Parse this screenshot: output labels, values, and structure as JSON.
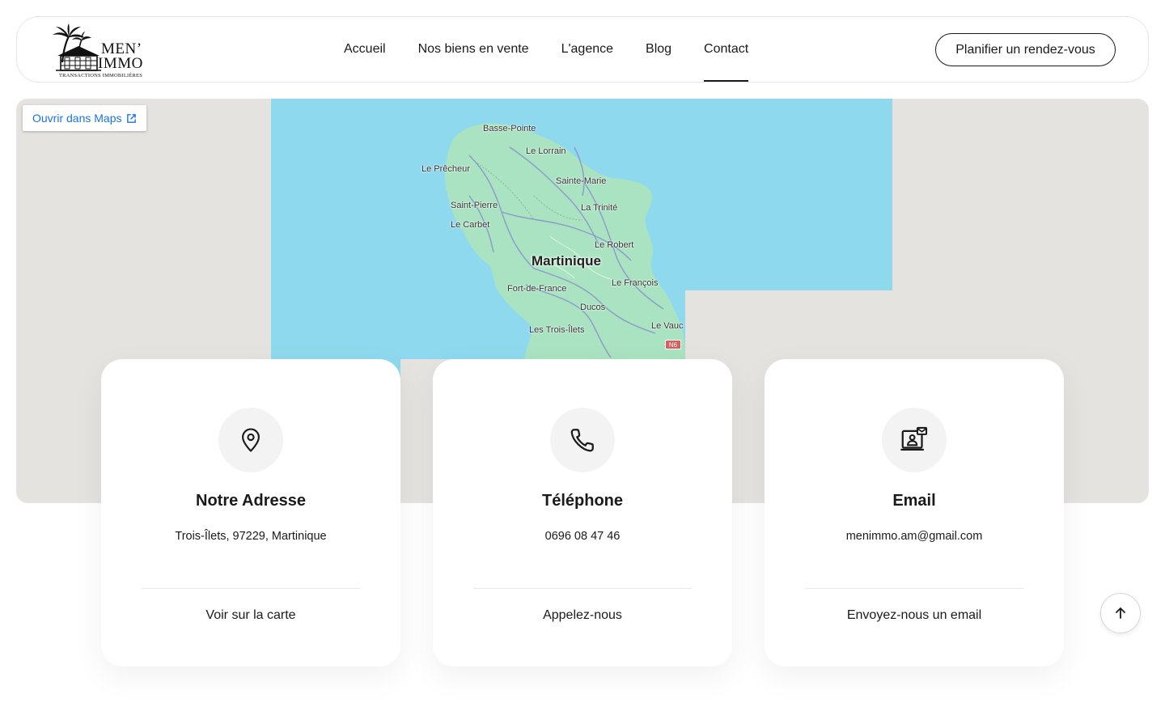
{
  "header": {
    "logo": {
      "brand_line1": "MEN’",
      "brand_line2": "IMMO",
      "tagline": "TRANSACTIONS IMMOBILIÈRES"
    },
    "nav": [
      {
        "label": "Accueil",
        "active": false
      },
      {
        "label": "Nos biens en vente",
        "active": false
      },
      {
        "label": "L'agence",
        "active": false
      },
      {
        "label": "Blog",
        "active": false
      },
      {
        "label": "Contact",
        "active": true
      }
    ],
    "cta_label": "Planifier un rendez-vous"
  },
  "map": {
    "open_link_label": "Ouvrir dans Maps",
    "region_label": "Martinique",
    "cities": [
      "Basse-Pointe",
      "Le Lorrain",
      "Le Prêcheur",
      "Sainte-Marie",
      "Saint-Pierre",
      "La Trinité",
      "Le Carbet",
      "Le Robert",
      "Le François",
      "Fort-de-France",
      "Ducos",
      "Les Trois-Îlets",
      "Le Vauc"
    ],
    "road_label": "N6",
    "colors": {
      "water": "#8fd9ee",
      "land": "#a9e3c1",
      "background": "#e4e3df"
    }
  },
  "cards": [
    {
      "icon": "location-pin-icon",
      "title": "Notre Adresse",
      "value": "Trois-Îlets, 97229, Martinique",
      "action": "Voir sur la carte"
    },
    {
      "icon": "phone-icon",
      "title": "Téléphone",
      "value": "0696 08 47 46",
      "action": "Appelez-nous"
    },
    {
      "icon": "email-icon",
      "title": "Email",
      "value": "menimmo.am@gmail.com",
      "action": "Envoyez-nous un email"
    }
  ],
  "scroll_top_icon": "arrow-up-icon"
}
